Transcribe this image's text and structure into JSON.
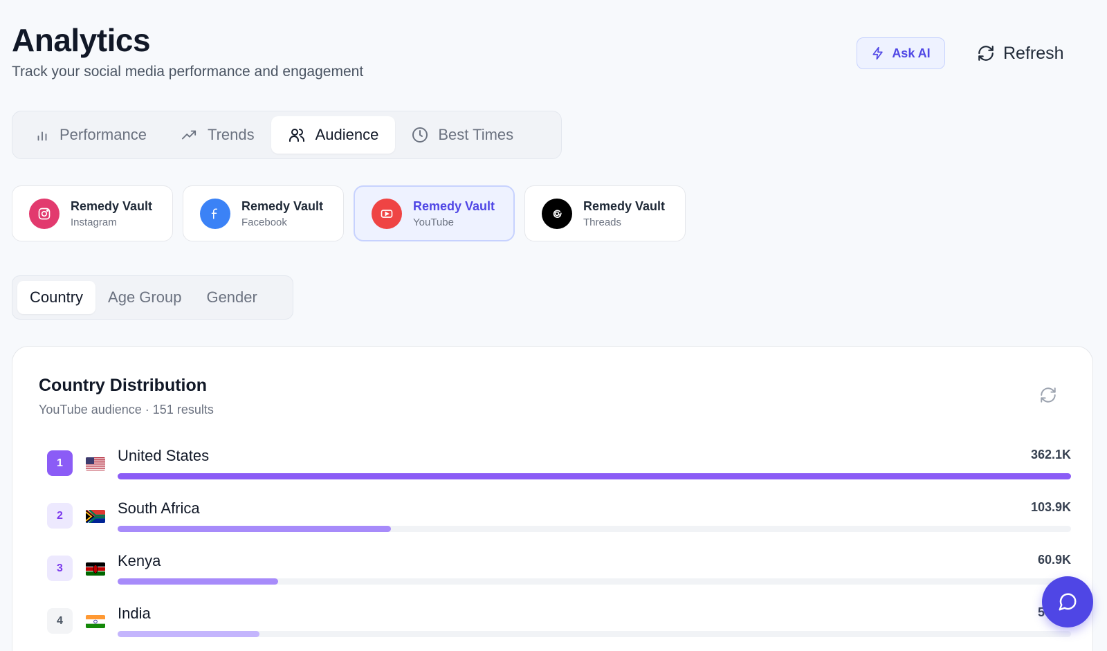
{
  "header": {
    "title": "Analytics",
    "subtitle": "Track your social media performance and engagement",
    "ask_ai_label": "Ask AI",
    "refresh_label": "Refresh"
  },
  "main_tabs": [
    {
      "label": "Performance",
      "icon": "bar-chart-icon",
      "active": false
    },
    {
      "label": "Trends",
      "icon": "trending-up-icon",
      "active": false
    },
    {
      "label": "Audience",
      "icon": "users-icon",
      "active": true
    },
    {
      "label": "Best Times",
      "icon": "clock-icon",
      "active": false
    }
  ],
  "accounts": [
    {
      "name": "Remedy Vault",
      "platform": "Instagram",
      "color": "#e1306c",
      "icon": "instagram-icon",
      "active": false
    },
    {
      "name": "Remedy Vault",
      "platform": "Facebook",
      "color": "#3b82f6",
      "icon": "facebook-icon",
      "active": false
    },
    {
      "name": "Remedy Vault",
      "platform": "YouTube",
      "color": "#ef4444",
      "icon": "youtube-icon",
      "active": true
    },
    {
      "name": "Remedy Vault",
      "platform": "Threads",
      "color": "#000000",
      "icon": "threads-icon",
      "active": false
    }
  ],
  "sub_tabs": [
    {
      "label": "Country",
      "active": true
    },
    {
      "label": "Age Group",
      "active": false
    },
    {
      "label": "Gender",
      "active": false
    }
  ],
  "distribution": {
    "title": "Country Distribution",
    "subtitle": "YouTube audience · 151 results",
    "rows": [
      {
        "rank": "1",
        "country": "United States",
        "value": "362.1K",
        "share": 1.0,
        "flag": "us-flag-icon"
      },
      {
        "rank": "2",
        "country": "South Africa",
        "value": "103.9K",
        "share": 0.287,
        "flag": "za-flag-icon"
      },
      {
        "rank": "3",
        "country": "Kenya",
        "value": "60.9K",
        "share": 0.168,
        "flag": "ke-flag-icon"
      },
      {
        "rank": "4",
        "country": "India",
        "value": "54.0K",
        "share": 0.149,
        "flag": "in-flag-icon"
      }
    ]
  },
  "colors": {
    "accent": "#4f46e5",
    "bar": "#8b5cf6"
  }
}
